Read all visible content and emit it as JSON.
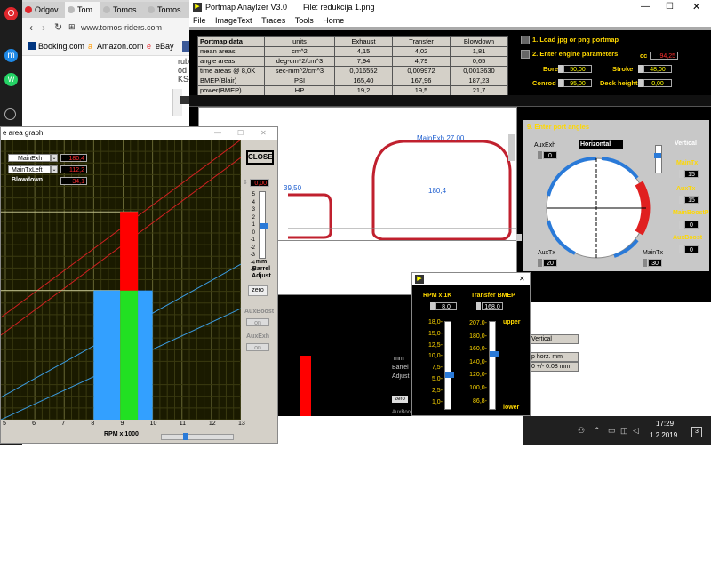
{
  "browser": {
    "tabs": [
      {
        "label": "Odgov"
      },
      {
        "label": "Tom"
      },
      {
        "label": "Tomos"
      },
      {
        "label": "Tomos"
      }
    ],
    "url": "www.tomos-riders.com",
    "bookmarks": [
      "Booking.com",
      "Amazon.com",
      "eBay"
    ],
    "page_text": [
      "rub",
      "od",
      "KS-"
    ]
  },
  "main": {
    "title": "Portmap Anaylzer V3.0",
    "file": "File: redukcija 1.png",
    "menu": [
      "File",
      "ImageText",
      "Traces",
      "Tools",
      "Home"
    ],
    "table": {
      "headers": [
        "Portmap data",
        "units",
        "Exhaust",
        "Transfer",
        "Blowdown"
      ],
      "rows": [
        [
          "mean areas",
          "cm^2",
          "4,15",
          "4,02",
          "1,81"
        ],
        [
          "angle areas",
          "deg-cm^2/cm^3",
          "7,94",
          "4,79",
          "0,65"
        ],
        [
          "time areas @ 8,0K",
          "sec-mm^2/cm^3",
          "0,016552",
          "0,009972",
          "0,0013630"
        ],
        [
          "BMEP(Blair)",
          "PSI",
          "165,40",
          "167,96",
          "187,23"
        ],
        [
          "power(BMEP)",
          "HP",
          "19,2",
          "19,5",
          "21,7"
        ]
      ]
    },
    "step1": "1. Load jpg or png portmap",
    "step2": "2. Enter engine parameters",
    "cc_label": "cc",
    "cc": "94,25",
    "bore_label": "Bore",
    "bore": "50,00",
    "stroke_label": "Stroke",
    "stroke": "48,00",
    "conrod_label": "Conrod",
    "conrod": "95,00",
    "deck_label": "Deck height",
    "deck": "0,00",
    "step9": "9. Enter port angles",
    "port": {
      "auxexh_label": "AuxExh",
      "auxexh": "0",
      "orient": "Horizontal",
      "vertical": "Vertical",
      "maintx_label": "MainTx",
      "maintx": "15",
      "auxtx_label": "AuxTx",
      "auxtx": "15",
      "mainboostp_label": "MainBoostP",
      "mainboostp": "0",
      "auxboost_label": "AuxBoost",
      "auxboost": "0",
      "auxtx_bottom_label": "AuxTx",
      "auxtx_bottom": "20",
      "maintx_bottom_label": "MainTx",
      "maintx_bottom": "30"
    },
    "canvas": {
      "mainexh_label": "MainExh 27,00",
      "mainexh_value": "180,4",
      "left_label": "39,50"
    },
    "lower": {
      "vertical": "Vertical",
      "horz": "p horz. mm",
      "tol": "0 +/- 0.08 mm"
    }
  },
  "graph": {
    "title": "e area graph",
    "close": "CLOSE",
    "rows": [
      {
        "name": "MainExh",
        "value": "180,4"
      },
      {
        "name": "MainTxLeft",
        "value": "112,2"
      },
      {
        "name": "Blowdown",
        "value": "34,1"
      }
    ],
    "adjust_value": "0,00",
    "adjust_scale": [
      "5",
      "4",
      "3",
      "2",
      "1",
      "0",
      "-1",
      "-2",
      "-3",
      "-4",
      "-5"
    ],
    "mm": "mm",
    "barrel": "Barrel",
    "adjust": "Adjust",
    "zero": "zero",
    "auxboost": "AuxBoost",
    "auxexh": "AuxExh",
    "on": "on",
    "xlabel": "RPM x 1000",
    "xticks": [
      "5",
      "6",
      "7",
      "8",
      "9",
      "10",
      "11",
      "12",
      "13"
    ],
    "behind_mm": "mm",
    "behind_barrel": "Barrel",
    "behind_adjust": "Adjust",
    "behind_zero": "zero",
    "behind_auxboost": "AuxBoost"
  },
  "rpm_dialog": {
    "rpm_label": "RPM x 1K",
    "rpm": "8,0",
    "bmep_label": "Transfer BMEP",
    "bmep": "168,0",
    "rpm_ticks": [
      "18,0-",
      "15,0-",
      "12,5-",
      "10,0-",
      "7,5-",
      "5,0-",
      "2,5-",
      "1,0-"
    ],
    "bmep_ticks": [
      "207,0-",
      "180,0-",
      "160,0-",
      "140,0-",
      "120,0-",
      "100,0-",
      "86,8-"
    ],
    "upper": "upper",
    "lower": "lower"
  },
  "taskbar": {
    "time": "17:29",
    "date": "1.2.2019.",
    "badge": "3"
  },
  "chart_data": {
    "type": "bar",
    "xlabel": "RPM x 1000",
    "xlim": [
      5,
      13
    ],
    "series": [
      {
        "name": "MainExh",
        "values": [
          180.4
        ],
        "color": "#ff0000"
      },
      {
        "name": "MainTxLeft",
        "values": [
          112.2
        ],
        "color": "#33a0ff"
      },
      {
        "name": "Blowdown",
        "values": [
          34.1
        ],
        "color": "#22e022"
      }
    ],
    "grid": true
  }
}
